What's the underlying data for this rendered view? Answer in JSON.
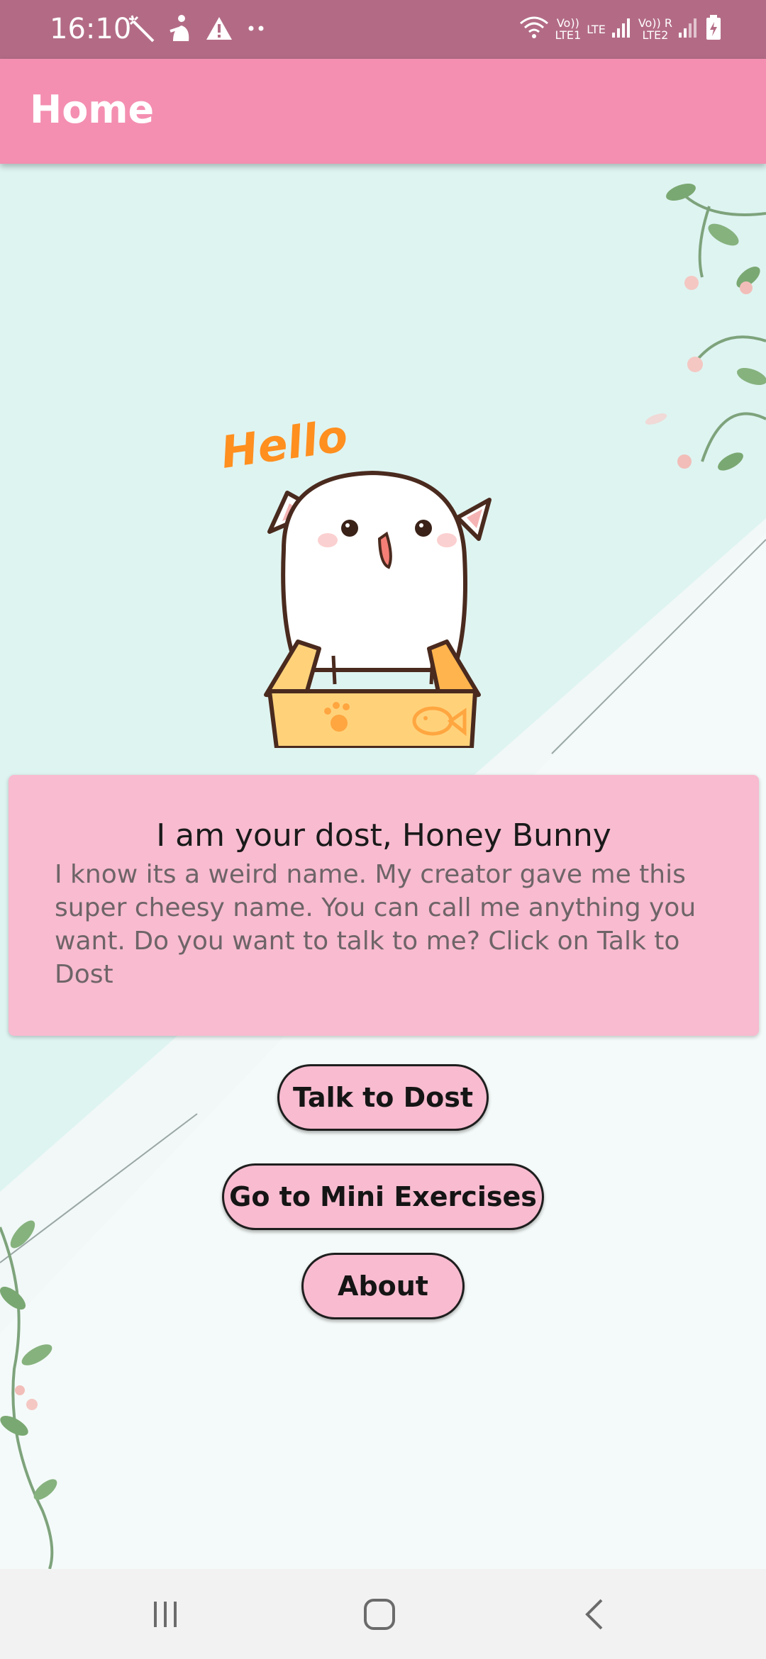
{
  "status_bar": {
    "time": "16:10",
    "left_icons": [
      "magic-wand-icon",
      "person-running-icon",
      "warning-icon",
      "more-dots-icon"
    ],
    "sim1_label_top": "Vo))",
    "sim1_label_bottom": "LTE1",
    "lte_label": "LTE",
    "sim2_label_top": "Vo)) R",
    "sim2_label_bottom": "LTE2",
    "right_icons": [
      "wifi-icon",
      "signal-icon",
      "signal-icon",
      "battery-charging-icon"
    ]
  },
  "app_bar": {
    "title": "Home"
  },
  "mascot": {
    "greeting": "Hello"
  },
  "intro_card": {
    "title": "I am your dost, Honey Bunny",
    "body": "I know its a weird name. My creator gave me this super cheesy name. You can call me anything you want. Do you want to talk to me? Click on Talk to Dost"
  },
  "buttons": {
    "talk": "Talk to Dost",
    "exercises": "Go to Mini Exercises",
    "about": "About"
  },
  "nav_bar": {
    "items": [
      "recent-apps-icon",
      "home-icon",
      "back-icon"
    ]
  },
  "colors": {
    "status_bar": "#b36b85",
    "app_bar": "#f48fb1",
    "card": "#f8bbd0",
    "button": "#f8bbd0"
  }
}
